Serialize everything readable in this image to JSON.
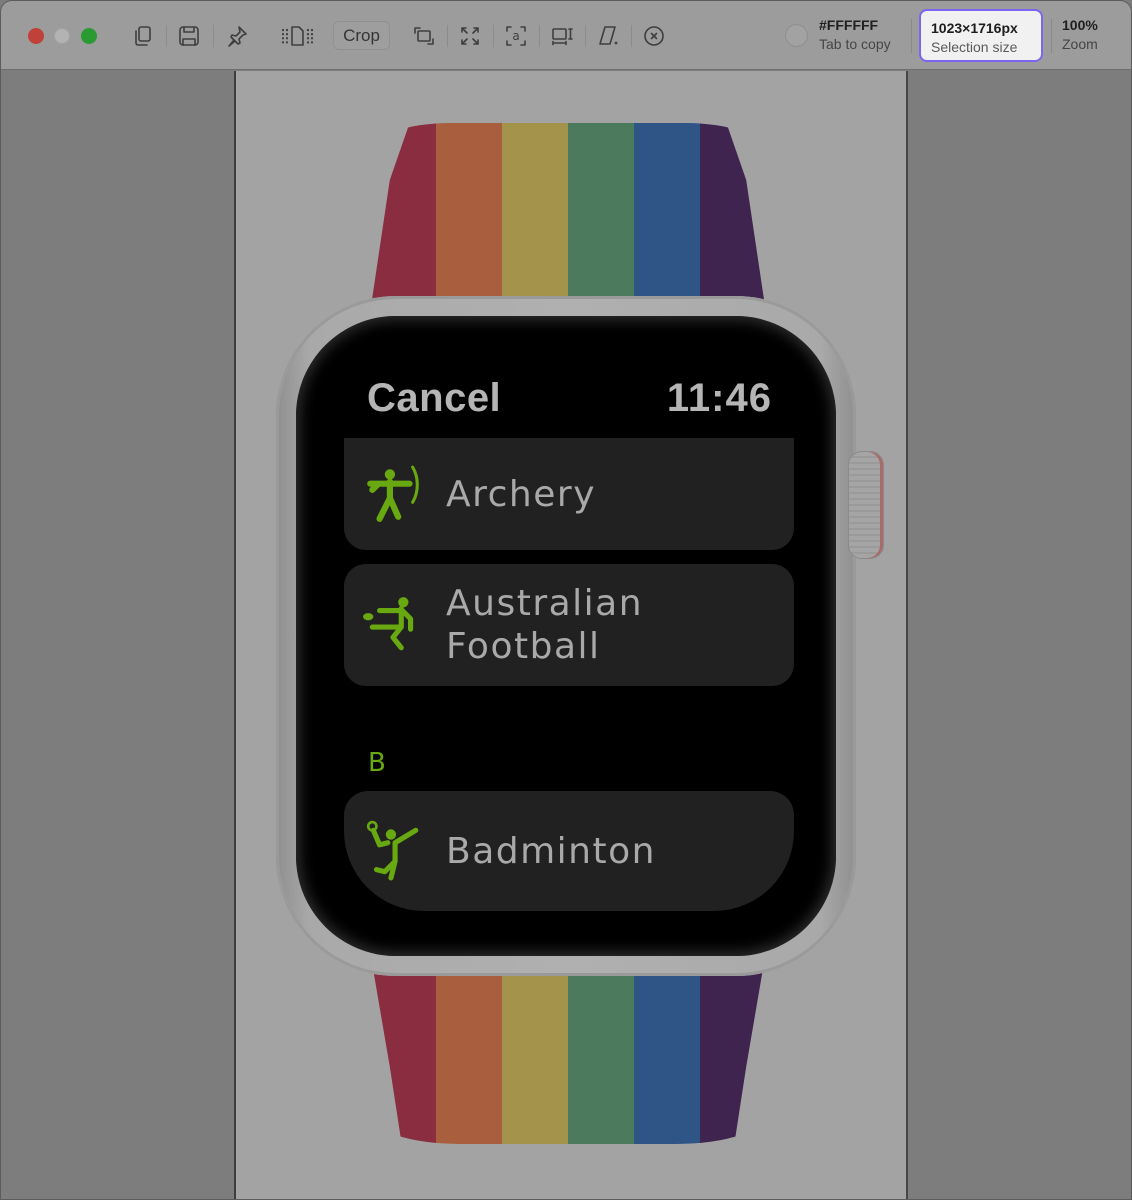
{
  "window": {
    "traffic_lights": [
      "close",
      "minimize",
      "maximize"
    ]
  },
  "toolbar": {
    "tools": [
      {
        "name": "copy",
        "icon": "copy-icon"
      },
      {
        "name": "save",
        "icon": "save-icon"
      },
      {
        "name": "pin",
        "icon": "pin-icon"
      },
      {
        "name": "drag-out",
        "icon": "drag-file-icon"
      },
      {
        "name": "overlay",
        "icon": "overlay-icon"
      },
      {
        "name": "expand",
        "icon": "expand-icon"
      },
      {
        "name": "recognize-text",
        "icon": "text-recognition-icon"
      },
      {
        "name": "dimensions",
        "icon": "dimensions-icon"
      },
      {
        "name": "erase",
        "icon": "eraser-icon"
      },
      {
        "name": "close",
        "icon": "close-circle-icon"
      }
    ],
    "crop_label": "Crop",
    "color": {
      "value": "#FFFFFF",
      "label": "Tab to copy"
    },
    "selection": {
      "value": "1023×1716px",
      "label": "Selection size"
    },
    "zoom": {
      "value": "100%",
      "label": "Zoom"
    },
    "accent_color": "#7B66EF"
  },
  "watch": {
    "band_colors": [
      "#8a2d40",
      "#a95f3e",
      "#a4934a",
      "#4b7a5c",
      "#2f5587",
      "#3f2450"
    ],
    "header": {
      "cancel_label": "Cancel",
      "time": "11:46"
    },
    "workouts": [
      {
        "name": "Archery",
        "icon": "archery-icon"
      },
      {
        "name": "Australian Football",
        "line1": "Australian",
        "line2": "Football",
        "icon": "australian-football-icon"
      },
      {
        "name": "Badminton",
        "icon": "badminton-icon"
      }
    ],
    "section_letter": "B",
    "icon_color": "#68a810"
  }
}
